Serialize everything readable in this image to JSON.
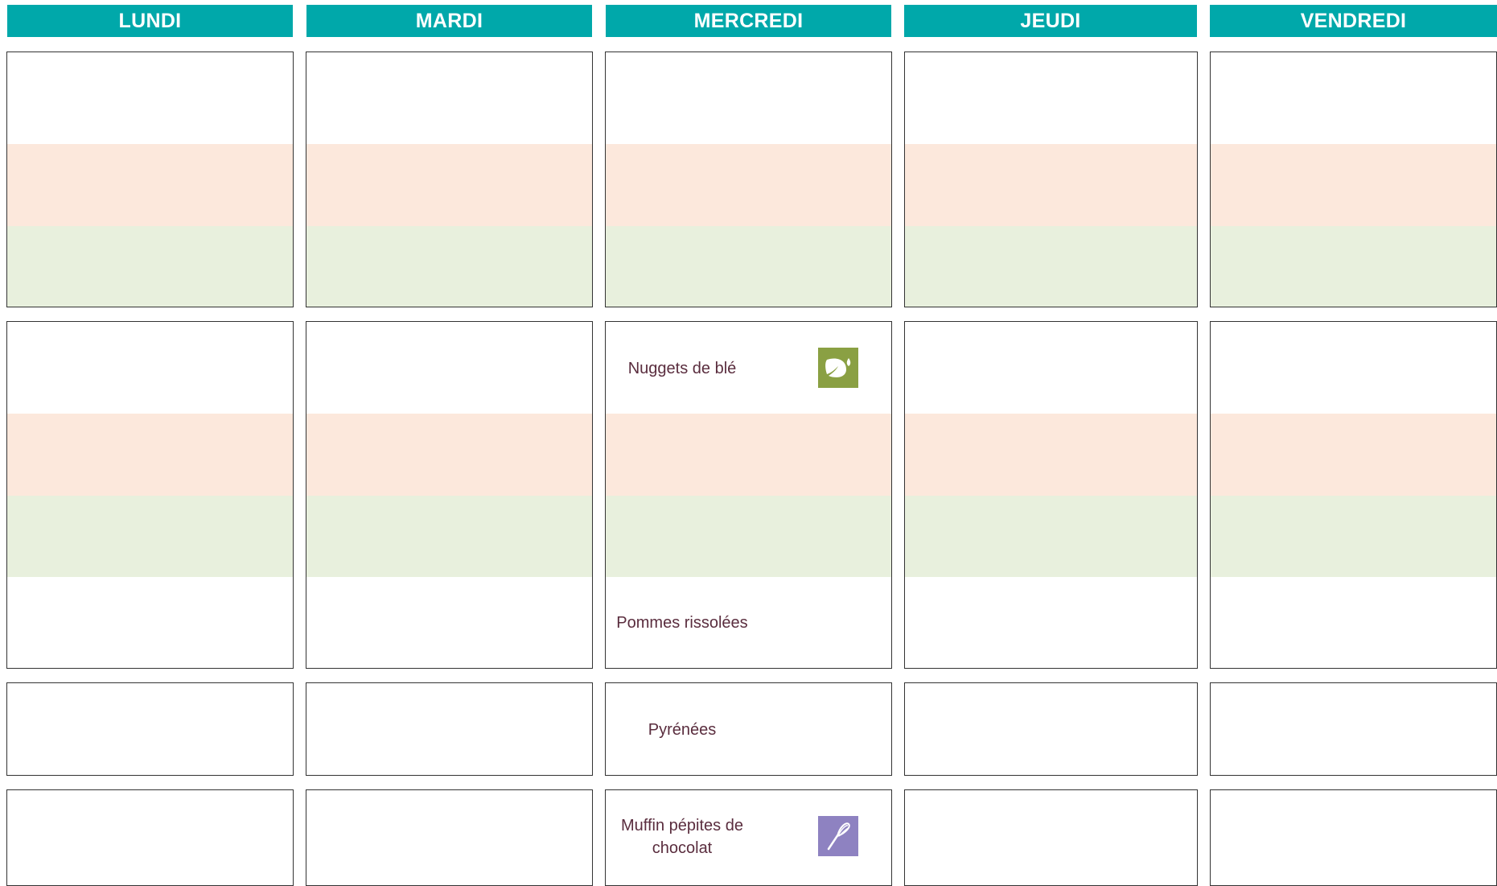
{
  "days": [
    "LUNDI",
    "MARDI",
    "MERCREDI",
    "JEUDI",
    "VENDREDI"
  ],
  "colors": {
    "header": "#00a8aa",
    "band_peach": "#fce8dc",
    "band_green": "#e8f0dd",
    "text": "#5a2d3e",
    "veg_icon": "#8aa043",
    "homemade_icon": "#8e82c1"
  },
  "menu": {
    "mercredi": {
      "main": "Nuggets de blé",
      "main_icon": "vegetarian-leaf-icon",
      "side": "Pommes rissolées",
      "cheese": "Pyrénées",
      "dessert_line1": "Muffin pépites de",
      "dessert_line2": "chocolat",
      "dessert_icon": "homemade-whisk-icon"
    }
  }
}
